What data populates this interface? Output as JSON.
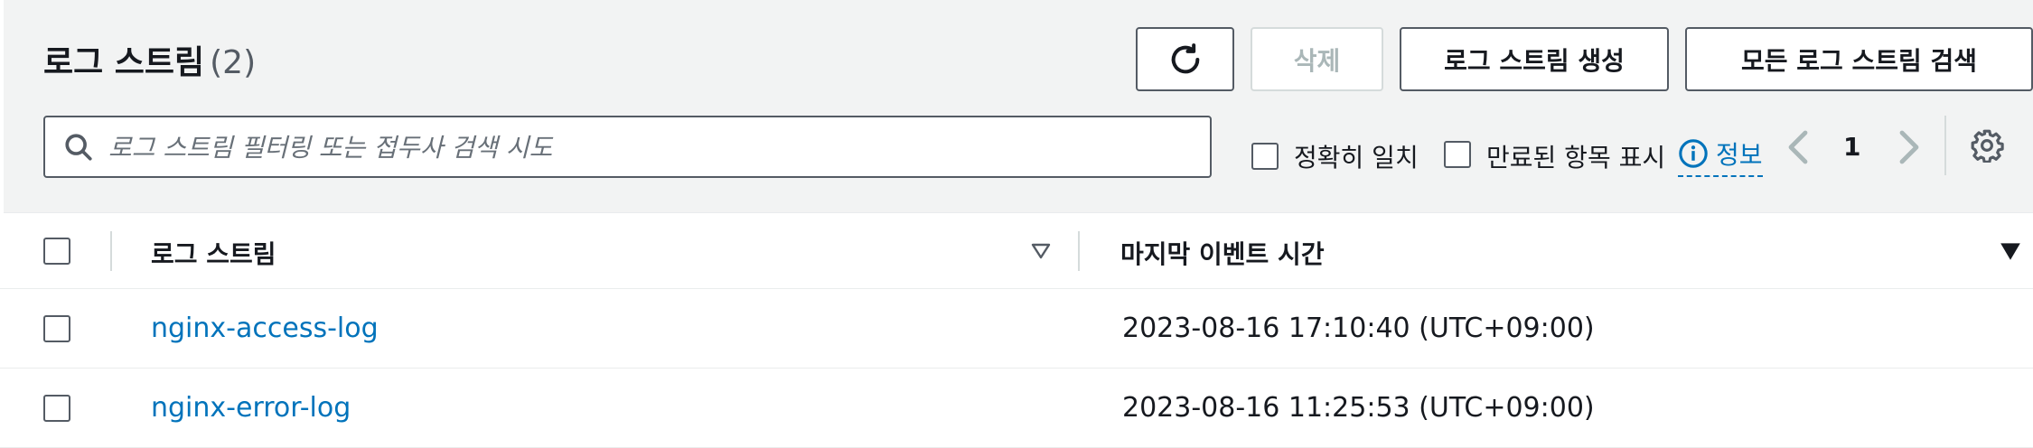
{
  "header": {
    "title": "로그 스트림",
    "count": "(2)"
  },
  "toolbar": {
    "delete_label": "삭제",
    "create_label": "로그 스트림 생성",
    "search_all_label": "모든 로그 스트림 검색"
  },
  "filter": {
    "placeholder": "로그 스트림 필터링 또는 접두사 검색 시도",
    "value": "",
    "exact_match_label": "정확히 일치",
    "show_expired_label": "만료된 항목 표시",
    "info_label": "정보"
  },
  "pagination": {
    "current_page": "1"
  },
  "table": {
    "columns": [
      "로그 스트림",
      "마지막 이벤트 시간"
    ],
    "rows": [
      {
        "name": "nginx-access-log",
        "last_event": "2023-08-16 17:10:40 (UTC+09:00)"
      },
      {
        "name": "nginx-error-log",
        "last_event": "2023-08-16 11:25:53 (UTC+09:00)"
      }
    ]
  },
  "colors": {
    "link": "#0073bb",
    "text": "#16191f",
    "header_bg": "#f2f3f3",
    "disabled": "#aab7b8"
  },
  "icons": [
    "refresh-icon",
    "search-icon",
    "info-icon",
    "chevron-left-icon",
    "chevron-right-icon",
    "gear-icon",
    "sort-descending-icon"
  ]
}
